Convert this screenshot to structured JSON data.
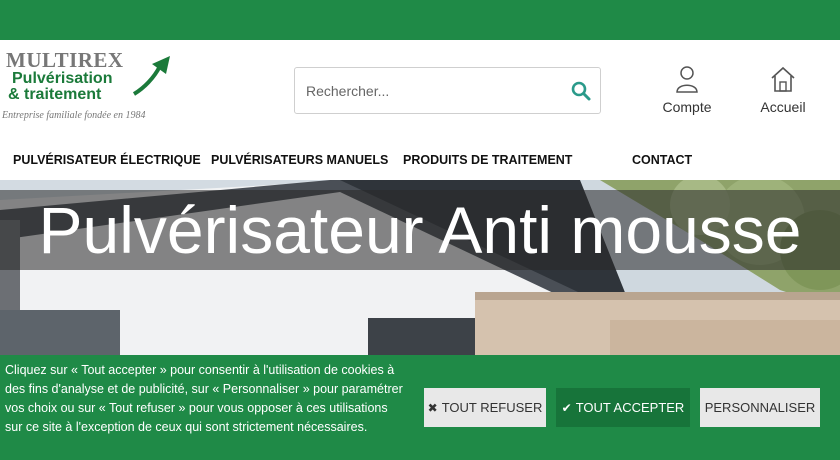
{
  "header": {
    "logo": {
      "brand": "MULTIREX",
      "line1": "Pulvérisation",
      "line2": "& traitement",
      "tagline": "Entreprise familiale fondée en 1984"
    },
    "search": {
      "placeholder": "Rechercher...",
      "icon": "search-icon"
    },
    "account_label": "Compte",
    "home_label": "Accueil"
  },
  "nav": {
    "items": [
      {
        "label": "PULVÉRISATEUR ÉLECTRIQUE"
      },
      {
        "label": "PULVÉRISATEURS MANUELS"
      },
      {
        "label": "PRODUITS DE TRAITEMENT"
      },
      {
        "label": "CONTACT"
      }
    ]
  },
  "hero": {
    "title": "Pulvérisateur Anti mousse"
  },
  "cookie": {
    "text": "Cliquez sur « Tout accepter » pour consentir à l'utilisation de cookies à des fins d'analyse et de publicité, sur « Personnaliser » pour paramétrer vos choix ou sur « Tout refuser » pour vous opposer à ces utilisations sur ce site à l'exception de ceux qui sont strictement nécessaires.",
    "refuse_label": "TOUT REFUSER",
    "accept_label": "TOUT ACCEPTER",
    "customize_label": "PERSONNALISER"
  },
  "colors": {
    "brand_green": "#1f8a47",
    "accept_green": "#17743a",
    "search_icon": "#2a9a8a"
  }
}
